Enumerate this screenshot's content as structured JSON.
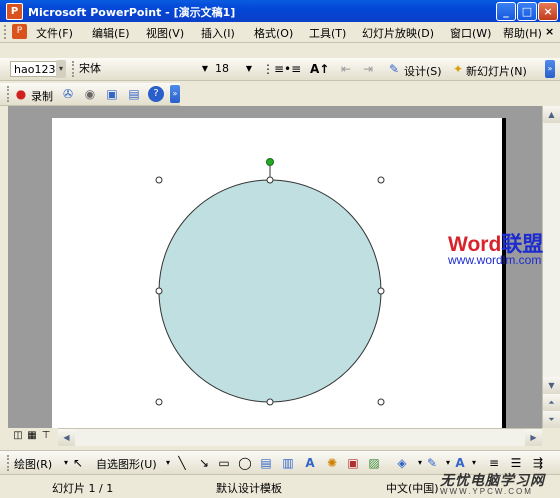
{
  "window": {
    "title": "Microsoft PowerPoint - [演示文稿1]",
    "app_icon": "powerpoint-icon",
    "controls": {
      "minimize": "_",
      "maximize": "□",
      "close": "×"
    }
  },
  "menubar": {
    "items": [
      {
        "label": "文件(F)"
      },
      {
        "label": "编辑(E)"
      },
      {
        "label": "视图(V)"
      },
      {
        "label": "插入(I)"
      },
      {
        "label": "格式(O)"
      },
      {
        "label": "工具(T)"
      },
      {
        "label": "幻灯片放映(D)"
      },
      {
        "label": "窗口(W)"
      },
      {
        "label": "帮助(H)"
      }
    ],
    "close_doc": "×"
  },
  "format_toolbar": {
    "style_value": "hao123",
    "font_value": "宋体",
    "size_value": "18",
    "design_label": "设计(S)",
    "new_slide_label": "新幻灯片(N)"
  },
  "record_toolbar": {
    "record_label": "录制"
  },
  "slide": {
    "circle_fill": "#bfdfe0",
    "circle_stroke": "#333333",
    "rotate_handle_color": "#22aa22"
  },
  "drawing_toolbar": {
    "draw_label": "绘图(R)",
    "autoshapes_label": "自选图形(U)"
  },
  "statusbar": {
    "slide_info": "幻灯片 1 / 1",
    "template": "默认设计模板",
    "language": "中文(中国)"
  },
  "watermarks": {
    "word_prefix": "Word",
    "word_suffix": "联盟",
    "url": "www.wordlm.com",
    "study_text": "无忧电脑学习网",
    "study_url": "WWW.YPCW.COM"
  },
  "colors": {
    "titlebar": "#0a4fd8",
    "word_red": "#d8232a",
    "word_blue": "#1c2bd0"
  }
}
